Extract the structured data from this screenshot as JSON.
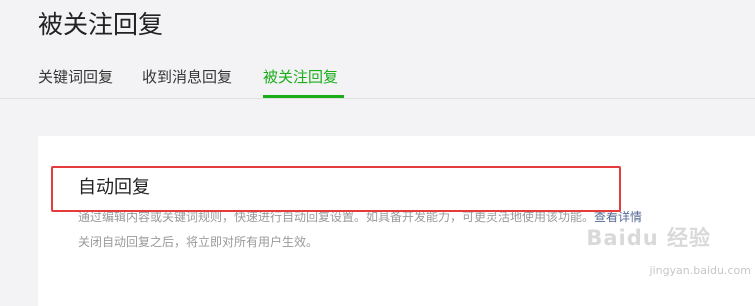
{
  "page": {
    "title": "被关注回复"
  },
  "tabs": [
    {
      "label": "关键词回复",
      "active": false
    },
    {
      "label": "收到消息回复",
      "active": false
    },
    {
      "label": "被关注回复",
      "active": true
    }
  ],
  "section": {
    "title": "自动回复",
    "description": "通过编辑内容或关键词规则，快速进行自动回复设置。如具备开发能力，可更灵活地使用该功能。",
    "link_label": "查看详情",
    "note": "关闭自动回复之后，将立即对所有用户生效。"
  },
  "watermark": {
    "brand": "Baidu 经验",
    "url": "jingyan.baidu.com"
  },
  "colors": {
    "accent": "#1aad19",
    "highlight_box": "#e53b3b",
    "link": "#576b95"
  }
}
